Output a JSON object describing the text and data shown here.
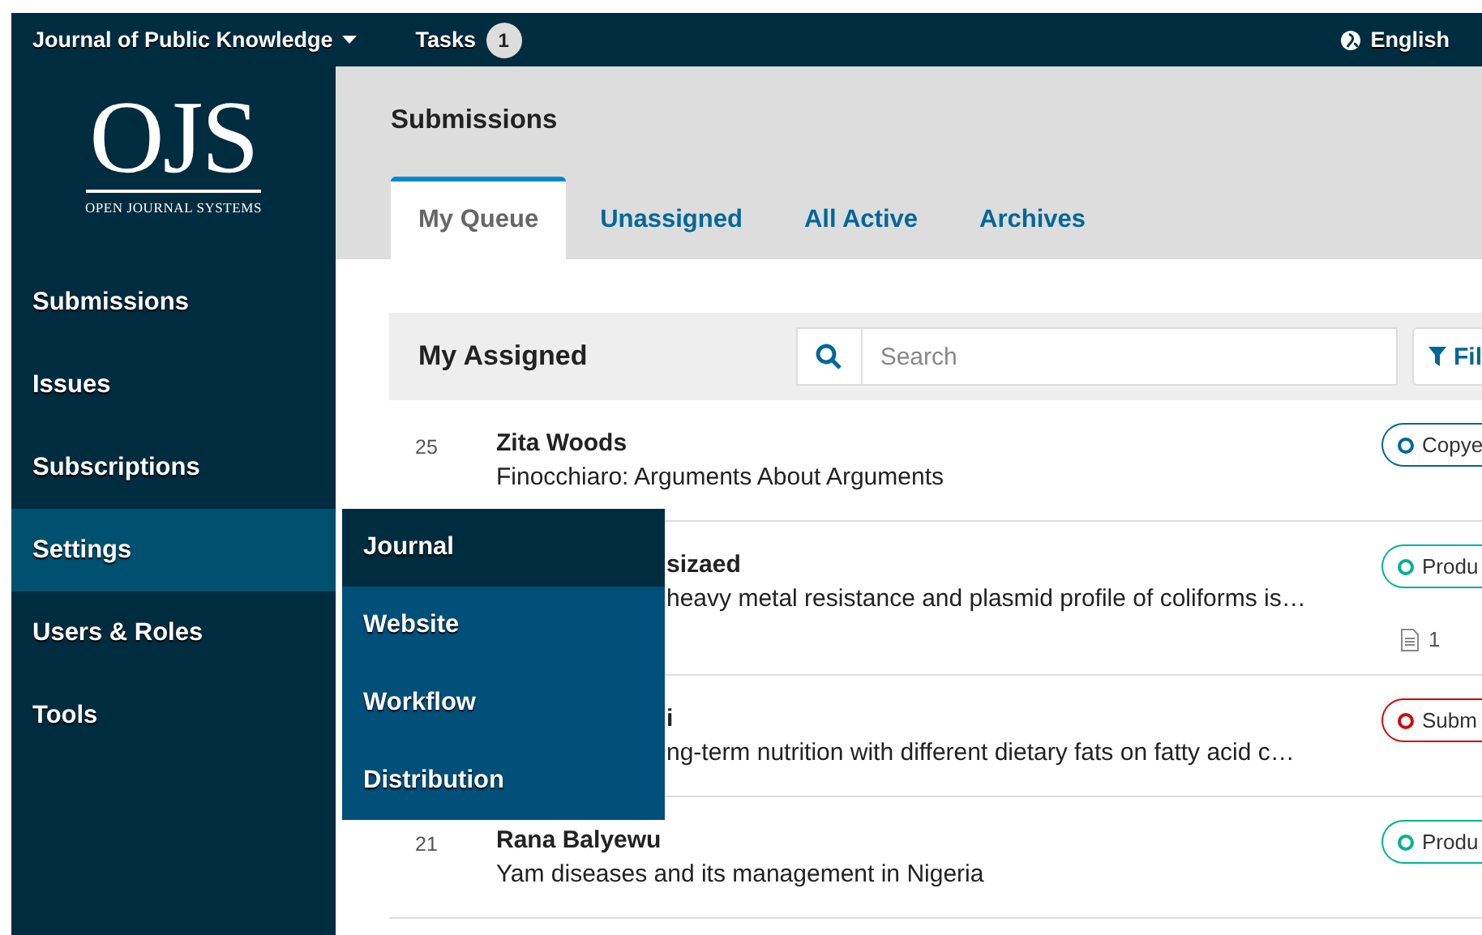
{
  "top_bar": {
    "context": "Journal of Public Knowledge",
    "tasks_label": "Tasks",
    "tasks_count": "1",
    "language": "English"
  },
  "logo": {
    "text": "OJS",
    "subtitle": "OPEN JOURNAL SYSTEMS"
  },
  "sidebar": {
    "items": [
      {
        "label": "Submissions",
        "selected": false
      },
      {
        "label": "Issues",
        "selected": false
      },
      {
        "label": "Subscriptions",
        "selected": false
      },
      {
        "label": "Settings",
        "selected": true,
        "submenu": [
          {
            "label": "Journal",
            "selected": true
          },
          {
            "label": "Website",
            "selected": false
          },
          {
            "label": "Workflow",
            "selected": false
          },
          {
            "label": "Distribution",
            "selected": false
          }
        ]
      },
      {
        "label": "Users & Roles",
        "selected": false
      },
      {
        "label": "Tools",
        "selected": false
      }
    ]
  },
  "page_title": "Submissions",
  "tabs": [
    {
      "label": "My Queue",
      "selected": true
    },
    {
      "label": "Unassigned",
      "selected": false
    },
    {
      "label": "All Active",
      "selected": false
    },
    {
      "label": "Archives",
      "selected": false
    }
  ],
  "list": {
    "title": "My Assigned",
    "search": {
      "placeholder": "Search"
    },
    "filter_label": "Fil",
    "rows": [
      {
        "kind": "full",
        "number": "25",
        "author": "Zita Woods",
        "title": "Finocchiaro: Arguments About Arguments",
        "stage": "Copye",
        "color": "#006798"
      },
      {
        "kind": "clipped",
        "author": "sizaed",
        "title": "heavy metal resistance and plasmid profile of coliforms is…",
        "stage": "Produ",
        "color": "#00b28e",
        "files": "1"
      },
      {
        "kind": "clipped",
        "author": "i",
        "title": "ng-term nutrition with different dietary fats on fatty acid c…",
        "stage": "Subm",
        "color": "#d00a0a"
      },
      {
        "kind": "full",
        "number": "21",
        "author": "Rana Balyewu",
        "title": "Yam diseases and its management in Nigeria",
        "stage": "Produ",
        "color": "#00b28e"
      }
    ]
  }
}
